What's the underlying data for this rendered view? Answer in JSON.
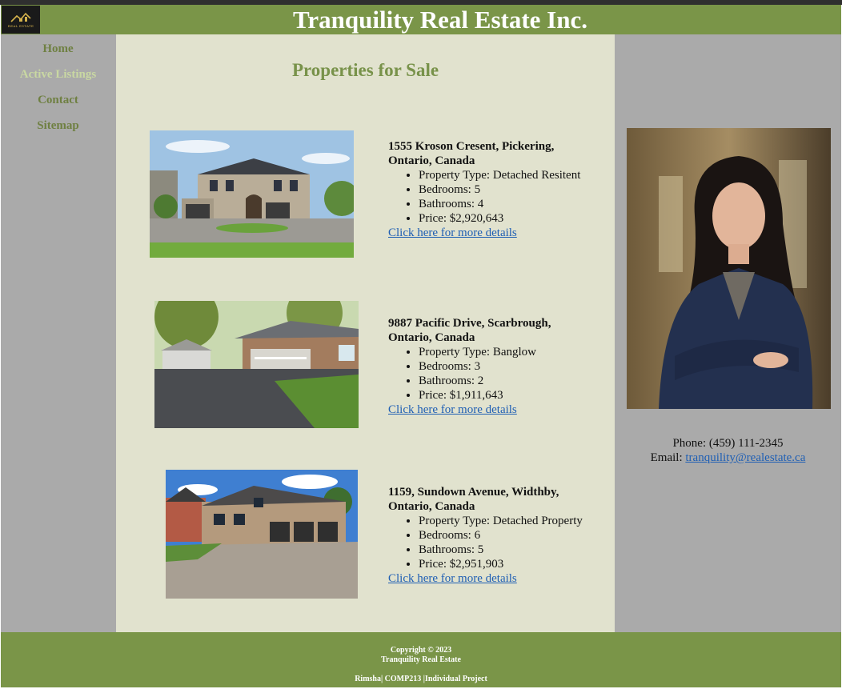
{
  "header": {
    "logo_text": "REAL ESTATE",
    "title": "Tranquility Real Estate Inc."
  },
  "nav": {
    "items": [
      {
        "label": "Home",
        "active": false
      },
      {
        "label": "Active Listings",
        "active": true
      },
      {
        "label": "Contact",
        "active": false
      },
      {
        "label": "Sitemap",
        "active": false
      }
    ]
  },
  "main": {
    "title": "Properties for Sale",
    "listings": [
      {
        "address": "1555 Kroson Cresent, Pickering, Ontario, Canada",
        "type": "Property Type: Detached Resitent",
        "bedrooms": "Bedrooms: 5",
        "bathrooms": "Bathrooms: 4",
        "price": "Price: $2,920,643",
        "link": "Click here for more details"
      },
      {
        "address": "9887 Pacific Drive, Scarbrough, Ontario, Canada",
        "type": "Property Type: Banglow",
        "bedrooms": "Bedrooms: 3",
        "bathrooms": "Bathrooms: 2",
        "price": "Price: $1,911,643",
        "link": "Click here for more details"
      },
      {
        "address": "1159, Sundown Avenue, Widthby, Ontario, Canada",
        "type": "Property Type: Detached Property",
        "bedrooms": "Bedrooms: 6",
        "bathrooms": "Bathrooms: 5",
        "price": "Price: $2,951,903",
        "link": "Click here for more details"
      }
    ]
  },
  "contact": {
    "phone": "Phone: (459) 111-2345",
    "email_label": "Email:",
    "email": "tranquility@realestate.ca"
  },
  "footer": {
    "copyright": "Copyright © 2023",
    "company": "Tranquility Real Estate",
    "credits": "Rimsha| COMP213 |Individual Project"
  },
  "colors": {
    "brand_green": "#7a9548",
    "main_bg": "#e1e2ce",
    "side_bg": "#aaaaaa",
    "link": "#1f5fb4"
  }
}
